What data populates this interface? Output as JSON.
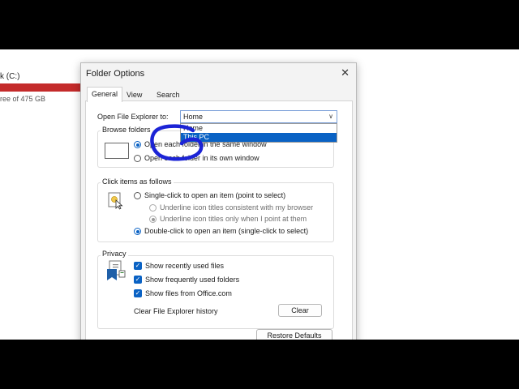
{
  "background": {
    "drive_label": "k (C:)",
    "drive_free": "ree of 475 GB",
    "drive_bar_color": "#c42b2b"
  },
  "dialog": {
    "title": "Folder Options",
    "close_glyph": "✕",
    "tabs": [
      {
        "label": "General",
        "active": true
      },
      {
        "label": "View",
        "active": false
      },
      {
        "label": "Search",
        "active": false
      }
    ],
    "open_explorer": {
      "label": "Open File Explorer to:",
      "value": "Home",
      "options": [
        "Home",
        "This PC"
      ],
      "highlighted": "This PC"
    },
    "browse_folders": {
      "legend": "Browse folders",
      "icon": "folder-window-icon",
      "options": [
        {
          "label": "Open each folder in the same window",
          "selected": true
        },
        {
          "label": "Open each folder in its own window",
          "selected": false
        }
      ]
    },
    "click_items": {
      "legend": "Click items as follows",
      "icon": "pointer-click-icon",
      "single_click": "Single-click to open an item (point to select)",
      "underline_browser": "Underline icon titles consistent with my browser",
      "underline_point": "Underline icon titles only when I point at them",
      "double_click": "Double-click to open an item (single-click to select)"
    },
    "privacy": {
      "legend": "Privacy",
      "icon": "privacy-document-icon",
      "show_recent": "Show recently used files",
      "show_frequent": "Show frequently used folders",
      "show_office": "Show files from Office.com",
      "clear_label": "Clear File Explorer history",
      "clear_button": "Clear"
    },
    "restore_button": "Restore Defaults",
    "accent_color": "#0a62c4"
  }
}
